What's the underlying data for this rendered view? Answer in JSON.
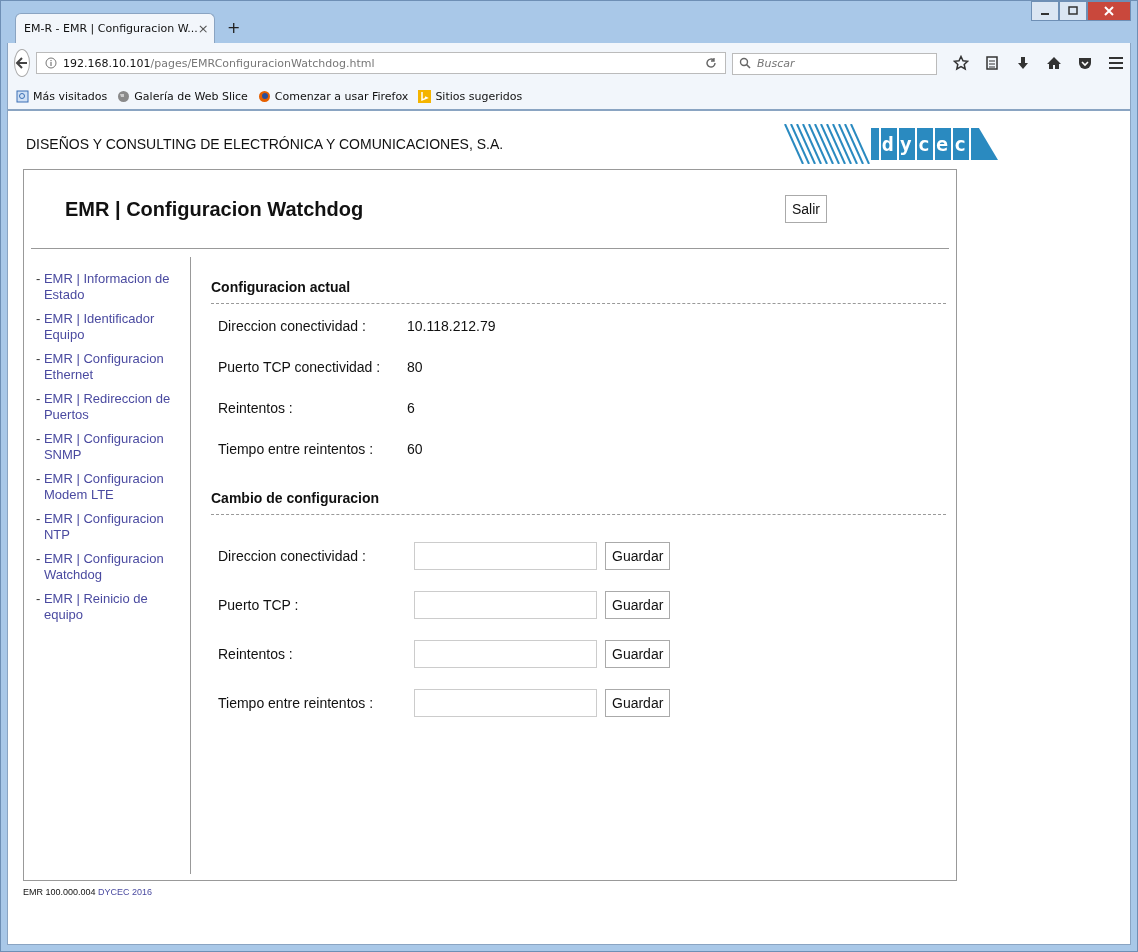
{
  "browser": {
    "tab_title": "EM-R - EMR | Configuracion W...",
    "tab_close": "×",
    "new_tab": "+",
    "url_host": "192.168.10.101",
    "url_path": "/pages/EMRConfiguracionWatchdog.html",
    "search": {
      "placeholder": "Buscar"
    },
    "bookmarks": [
      {
        "label": "Más visitados",
        "kind": "page"
      },
      {
        "label": "Galería de Web Slice",
        "kind": "globe"
      },
      {
        "label": "Comenzar a usar Firefox",
        "kind": "firefox"
      },
      {
        "label": "Sitios sugeridos",
        "kind": "bing"
      }
    ]
  },
  "company": "DISEÑOS Y CONSULTING DE ELECTRÓNICA Y COMUNICACIONES, S.A.",
  "logo": "dycec",
  "page_title": "EMR | Configuracion Watchdog",
  "logout_button": "Salir",
  "sidebar": {
    "items": [
      {
        "prefix": "- ",
        "label": "EMR | Informacion de Estado"
      },
      {
        "prefix": "- ",
        "label": "EMR | Identificador Equipo"
      },
      {
        "prefix": "- ",
        "label": "EMR | Configuracion Ethernet"
      },
      {
        "prefix": "- ",
        "label": "EMR | Redireccion de Puertos"
      },
      {
        "prefix": "- ",
        "label": "EMR | Configuracion SNMP"
      },
      {
        "prefix": "- ",
        "label": "EMR | Configuracion Modem LTE"
      },
      {
        "prefix": "- ",
        "label": "EMR | Configuracion NTP"
      },
      {
        "prefix": "- ",
        "label": "EMR | Configuracion Watchdog"
      },
      {
        "prefix": "- ",
        "label": "EMR | Reinicio de equipo"
      }
    ]
  },
  "current": {
    "heading": "Configuracion actual",
    "rows": [
      {
        "label": "Direccion conectividad :",
        "value": "10.118.212.79"
      },
      {
        "label": "Puerto TCP conectividad :",
        "value": "80"
      },
      {
        "label": "Reintentos :",
        "value": "6"
      },
      {
        "label": "Tiempo entre reintentos :",
        "value": "60"
      }
    ]
  },
  "change": {
    "heading": "Cambio de configuracion",
    "rows": [
      {
        "label": "Direccion conectividad :",
        "button": "Guardar"
      },
      {
        "label": "Puerto TCP :",
        "button": "Guardar"
      },
      {
        "label": "Reintentos :",
        "button": "Guardar"
      },
      {
        "label": "Tiempo entre reintentos :",
        "button": "Guardar"
      }
    ]
  },
  "footer": {
    "version": "EMR 100.000.004",
    "link": "DYCEC 2016"
  }
}
